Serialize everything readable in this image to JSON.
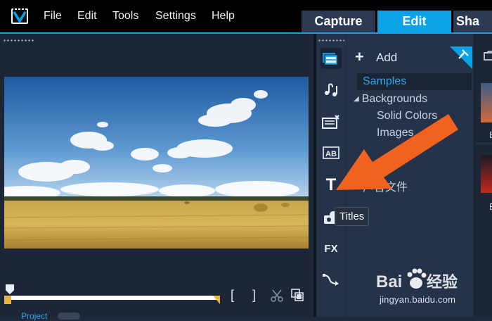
{
  "menu": {
    "file": "File",
    "edit": "Edit",
    "tools": "Tools",
    "settings": "Settings",
    "help": "Help"
  },
  "tabs": {
    "capture": "Capture",
    "edit": "Edit",
    "share": "Sha"
  },
  "library": {
    "add_label": "Add",
    "tree": {
      "samples": "Samples",
      "backgrounds": "Backgrounds",
      "solid_colors": "Solid Colors",
      "images": "Images",
      "audio_files": "声音文件"
    },
    "thumb_labels": [
      "E",
      "E"
    ]
  },
  "tooltip": "Titles",
  "project_label": "Project",
  "watermark": {
    "brand": "Baidu经验",
    "url": "jingyan.baidu.com"
  },
  "colors": {
    "accent": "#0ba2e8",
    "arrow": "#f0621e"
  }
}
